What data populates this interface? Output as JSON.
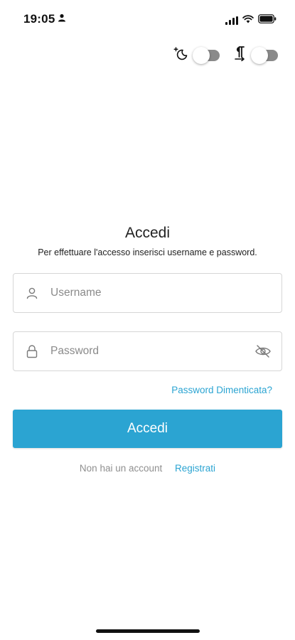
{
  "status_bar": {
    "time": "19:05",
    "icons": [
      "person-icon",
      "signal-icon",
      "wifi-icon",
      "battery-icon"
    ]
  },
  "toggles": {
    "dark_mode": {
      "icon": "moon-sparkle-icon",
      "enabled": false
    },
    "text_direction": {
      "icon": "paragraph-icon",
      "enabled": false
    }
  },
  "login": {
    "title": "Accedi",
    "subtitle": "Per effettuare l'accesso inserisci username e password.",
    "username_placeholder": "Username",
    "username_value": "",
    "password_placeholder": "Password",
    "password_value": "",
    "forgot_password": "Password Dimenticata?",
    "submit_label": "Accedi",
    "no_account_text": "Non hai un account",
    "register_label": "Registrati"
  },
  "colors": {
    "accent": "#2ba4d2",
    "toggle_track": "#8a8a8a",
    "input_border": "#d6d6d6",
    "muted_text": "#8f8f8f"
  }
}
